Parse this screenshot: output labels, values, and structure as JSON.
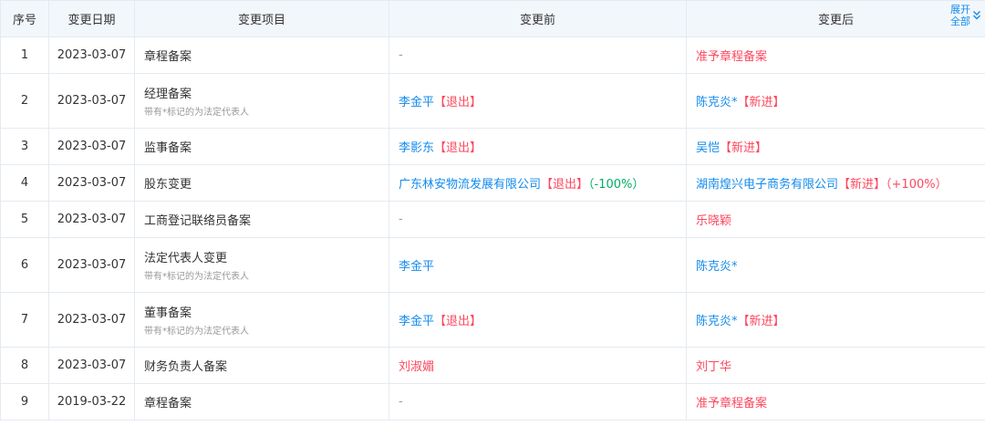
{
  "header": {
    "index": "序号",
    "date": "变更日期",
    "item": "变更项目",
    "before": "变更前",
    "after": "变更后",
    "expand_line1": "展开",
    "expand_line2": "全部"
  },
  "rows": [
    {
      "index": "1",
      "date": "2023-03-07",
      "item": "章程备案",
      "note": "",
      "before": [
        {
          "text": "-",
          "color": "gray"
        }
      ],
      "after": [
        {
          "text": "准予章程备案",
          "color": "red"
        }
      ]
    },
    {
      "index": "2",
      "date": "2023-03-07",
      "item": "经理备案",
      "note": "带有*标记的为法定代表人",
      "before": [
        {
          "text": "李金平",
          "color": "blue"
        },
        {
          "text": "【退出】",
          "color": "red"
        }
      ],
      "after": [
        {
          "text": "陈克炎*",
          "color": "blue"
        },
        {
          "text": "【新进】",
          "color": "red"
        }
      ]
    },
    {
      "index": "3",
      "date": "2023-03-07",
      "item": "监事备案",
      "note": "",
      "before": [
        {
          "text": "李影东",
          "color": "blue"
        },
        {
          "text": "【退出】",
          "color": "red"
        }
      ],
      "after": [
        {
          "text": "吴恺",
          "color": "blue"
        },
        {
          "text": "【新进】",
          "color": "red"
        }
      ]
    },
    {
      "index": "4",
      "date": "2023-03-07",
      "item": "股东变更",
      "note": "",
      "before": [
        {
          "text": "广东林安物流发展有限公司",
          "color": "blue"
        },
        {
          "text": "【退出】",
          "color": "red"
        },
        {
          "text": "（-100%）",
          "color": "green"
        }
      ],
      "after": [
        {
          "text": "湖南煌兴电子商务有限公司",
          "color": "blue"
        },
        {
          "text": "【新进】",
          "color": "red"
        },
        {
          "text": "（+100%）",
          "color": "red"
        }
      ]
    },
    {
      "index": "5",
      "date": "2023-03-07",
      "item": "工商登记联络员备案",
      "note": "",
      "before": [
        {
          "text": "-",
          "color": "gray"
        }
      ],
      "after": [
        {
          "text": "乐晓颖",
          "color": "red"
        }
      ]
    },
    {
      "index": "6",
      "date": "2023-03-07",
      "item": "法定代表人变更",
      "note": "带有*标记的为法定代表人",
      "before": [
        {
          "text": "李金平",
          "color": "blue"
        }
      ],
      "after": [
        {
          "text": "陈克炎*",
          "color": "blue"
        }
      ]
    },
    {
      "index": "7",
      "date": "2023-03-07",
      "item": "董事备案",
      "note": "带有*标记的为法定代表人",
      "before": [
        {
          "text": "李金平",
          "color": "blue"
        },
        {
          "text": "【退出】",
          "color": "red"
        }
      ],
      "after": [
        {
          "text": "陈克炎*",
          "color": "blue"
        },
        {
          "text": "【新进】",
          "color": "red"
        }
      ]
    },
    {
      "index": "8",
      "date": "2023-03-07",
      "item": "财务负责人备案",
      "note": "",
      "before": [
        {
          "text": "刘淑媚",
          "color": "red"
        }
      ],
      "after": [
        {
          "text": "刘丁华",
          "color": "red"
        }
      ]
    },
    {
      "index": "9",
      "date": "2019-03-22",
      "item": "章程备案",
      "note": "",
      "before": [
        {
          "text": "-",
          "color": "gray"
        }
      ],
      "after": [
        {
          "text": "准予章程备案",
          "color": "red"
        }
      ]
    }
  ],
  "colors": {
    "blue": "#128bed",
    "red": "#fd485e",
    "green": "#00ad65",
    "gray": "#999999",
    "header_bg": "#f2f7fc",
    "border": "#e4eaf2"
  },
  "icons": {
    "expand": "chevron-double-down-icon"
  }
}
